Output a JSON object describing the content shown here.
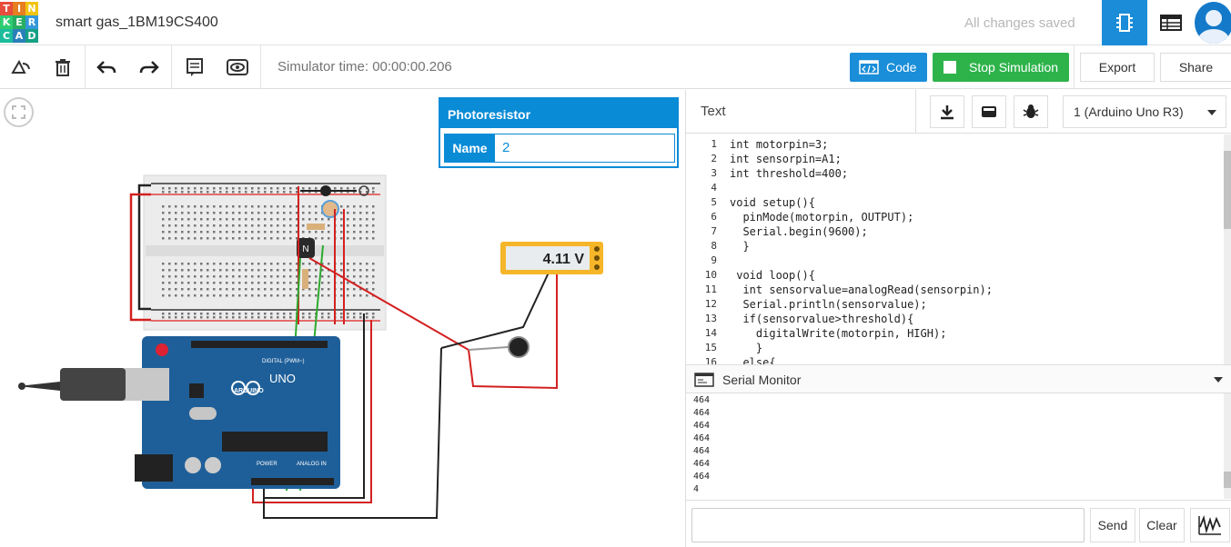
{
  "app": {
    "logo_letters": [
      "T",
      "I",
      "N",
      "K",
      "E",
      "R",
      "C",
      "A",
      "D"
    ],
    "logo_colors": [
      "#e74c3c",
      "#e67e22",
      "#f1c40f",
      "#2ecc71",
      "#27ae60",
      "#3498db",
      "#1abc9c",
      "#2980b9",
      "#16a085"
    ],
    "project_title": "smart gas_1BM19CS400",
    "save_status": "All changes saved"
  },
  "toolbar": {
    "simulator_time": "Simulator time: 00:00:00.206",
    "code_label": "Code",
    "stop_label": "Stop Simulation",
    "export_label": "Export",
    "share_label": "Share"
  },
  "inspector": {
    "title": "Photoresistor",
    "name_label": "Name",
    "name_value": "2"
  },
  "circuit": {
    "multimeter_reading": "4.11 V",
    "transistor_label": "N",
    "arduino_brand": "ARDUINO",
    "arduino_model": "UNO",
    "digital_label": "DIGITAL (PWM~)",
    "power_label": "POWER",
    "analog_label": "ANALOG IN"
  },
  "code_panel": {
    "mode_label": "Text",
    "device_select": "1 (Arduino Uno R3)",
    "lines": [
      {
        "n": "1",
        "code": "int motorpin=3;"
      },
      {
        "n": "2",
        "code": "int sensorpin=A1;"
      },
      {
        "n": "3",
        "code": "int threshold=400;"
      },
      {
        "n": "4",
        "code": ""
      },
      {
        "n": "5",
        "code": "void setup(){"
      },
      {
        "n": "6",
        "code": "  pinMode(motorpin, OUTPUT);"
      },
      {
        "n": "7",
        "code": "  Serial.begin(9600);"
      },
      {
        "n": "8",
        "code": "  }"
      },
      {
        "n": "9",
        "code": ""
      },
      {
        "n": "10",
        "code": " void loop(){"
      },
      {
        "n": "11",
        "code": "  int sensorvalue=analogRead(sensorpin);"
      },
      {
        "n": "12",
        "code": "  Serial.println(sensorvalue);"
      },
      {
        "n": "13",
        "code": "  if(sensorvalue>threshold){"
      },
      {
        "n": "14",
        "code": "    digitalWrite(motorpin, HIGH);"
      },
      {
        "n": "15",
        "code": "    }"
      },
      {
        "n": "16",
        "code": "  else{"
      }
    ]
  },
  "serial_monitor": {
    "title": "Serial Monitor",
    "output": [
      "464",
      "464",
      "464",
      "464",
      "464",
      "464",
      "464",
      "4"
    ],
    "send_label": "Send",
    "clear_label": "Clear"
  }
}
